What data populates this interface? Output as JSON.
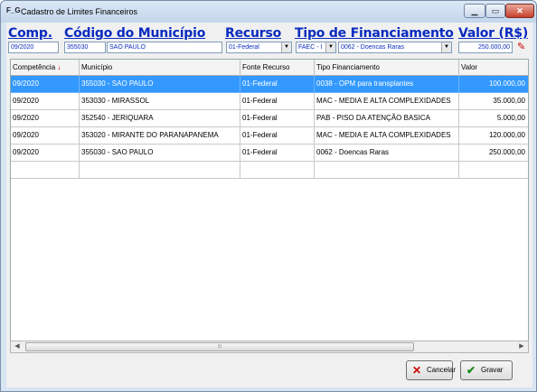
{
  "window": {
    "title": "Cadastro de Limites Financeiros",
    "app_icon": "F_G"
  },
  "form": {
    "headers": {
      "comp": "Comp.",
      "codigo": "Código do Município",
      "recurso": "Recurso",
      "tipo": "Tipo de Financiamento",
      "valor": "Valor (R$)"
    },
    "comp_value": "09/2020",
    "codigo_value": "355030",
    "municipio_value": "SAO PAULO",
    "recurso_value": "01-Federal",
    "tipo_bloco_value": "FAEC - I",
    "tipo_value": "0062 - Doencas Raras",
    "valor_value": "250.000,00"
  },
  "grid": {
    "columns": [
      "Competência",
      "Município",
      "Fonte Recurso",
      "Tipo Financiamento",
      "Valor"
    ],
    "rows": [
      {
        "competencia": "09/2020",
        "municipio": "355030 - SAO PAULO",
        "fonte": "01-Federal",
        "tipo": "0038 - OPM para transplantes",
        "valor": "100.000,00"
      },
      {
        "competencia": "09/2020",
        "municipio": "353030 - MIRASSOL",
        "fonte": "01-Federal",
        "tipo": "MAC - MEDIA E ALTA COMPLEXIDADES",
        "valor": "35.000,00"
      },
      {
        "competencia": "09/2020",
        "municipio": "352540 - JERIQUARA",
        "fonte": "01-Federal",
        "tipo": "PAB - PISO DA ATENÇÃO BASICA",
        "valor": "5.000,00"
      },
      {
        "competencia": "09/2020",
        "municipio": "353020 - MIRANTE DO PARANAPANEMA",
        "fonte": "01-Federal",
        "tipo": "MAC - MEDIA E ALTA COMPLEXIDADES",
        "valor": "120.000,00"
      },
      {
        "competencia": "09/2020",
        "municipio": "355030 - SAO PAULO",
        "fonte": "01-Federal",
        "tipo": "0062 - Doencas Raras",
        "valor": "250.000,00"
      }
    ],
    "selected_row": 0
  },
  "buttons": {
    "cancel": "Cancelar",
    "save": "Gravar"
  },
  "colors": {
    "header_text": "#0a2bbf",
    "selection": "#3399ff"
  }
}
